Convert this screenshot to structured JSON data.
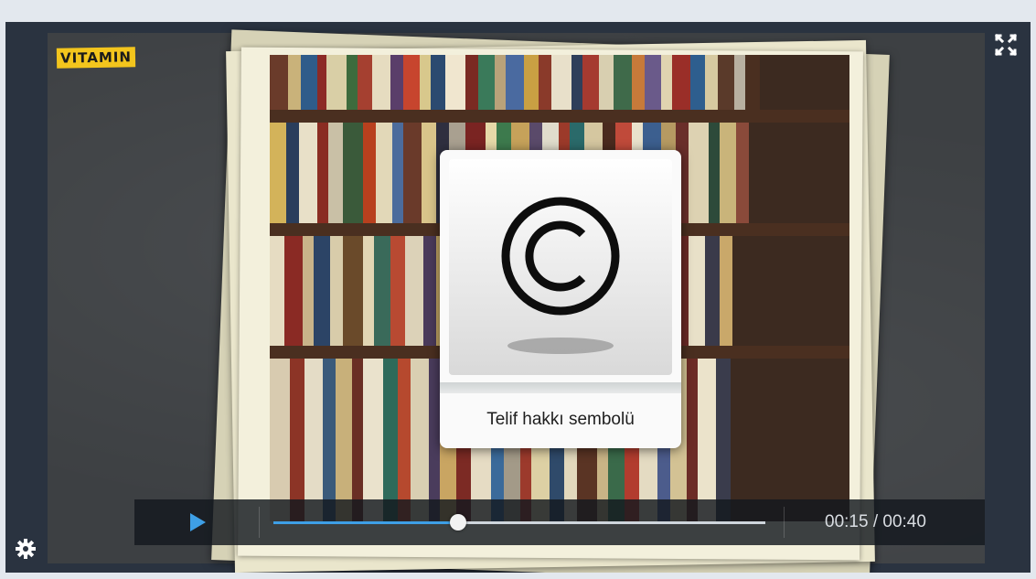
{
  "brand": {
    "logo_text": "VITAMIN",
    "logo_color": "#f3c51d"
  },
  "card": {
    "caption": "Telif hakkı sembolü",
    "symbol_icon": "copyright-icon"
  },
  "controls": {
    "play_icon": "play-icon",
    "current_time": "00:15",
    "separator": " / ",
    "duration": "00:40",
    "progress": 0.375,
    "accent_color": "#3e9fe6"
  },
  "toolbar": {
    "fullscreen_icon": "fullscreen-icon",
    "settings_icon": "gear-icon"
  }
}
